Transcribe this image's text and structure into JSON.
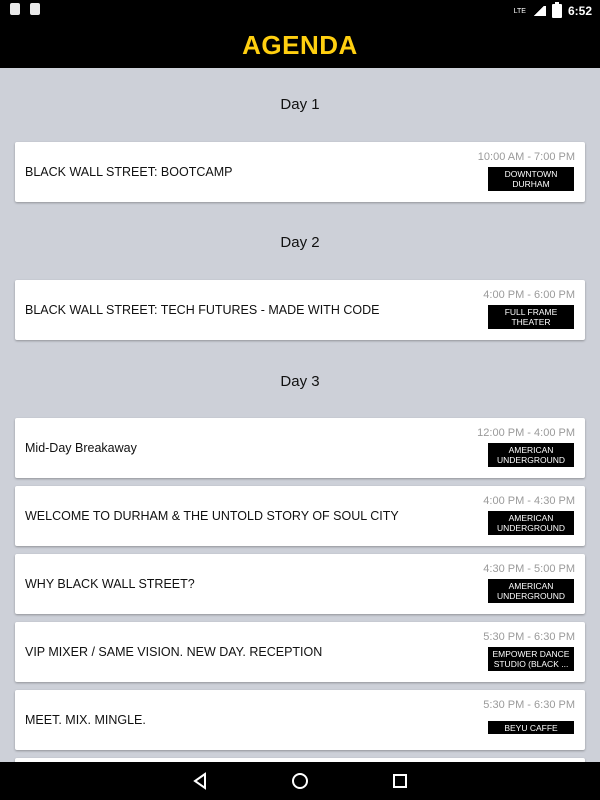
{
  "app": {
    "title": "AGENDA"
  },
  "status_bar": {
    "time": "6:52",
    "network": "LTE"
  },
  "days": [
    {
      "label": "Day 1",
      "events": [
        {
          "title": "BLACK WALL STREET: BOOTCAMP",
          "time": "10:00 AM - 7:00 PM",
          "location": "DOWNTOWN DURHAM"
        }
      ]
    },
    {
      "label": "Day 2",
      "events": [
        {
          "title": "BLACK WALL STREET: TECH FUTURES - MADE WITH CODE",
          "time": "4:00 PM - 6:00 PM",
          "location": "FULL FRAME THEATER"
        }
      ]
    },
    {
      "label": "Day 3",
      "events": [
        {
          "title": "Mid-Day Breakaway",
          "time": "12:00 PM - 4:00 PM",
          "location": "AMERICAN UNDERGROUND"
        },
        {
          "title": "WELCOME TO DURHAM & THE UNTOLD STORY OF SOUL CITY",
          "time": "4:00 PM - 4:30 PM",
          "location": "AMERICAN UNDERGROUND"
        },
        {
          "title": "WHY BLACK WALL STREET?",
          "time": "4:30 PM - 5:00 PM",
          "location": "AMERICAN UNDERGROUND"
        },
        {
          "title": "VIP MIXER / SAME VISION. NEW DAY. RECEPTION",
          "time": "5:30 PM - 6:30 PM",
          "location": "EMPOWER DANCE STUDIO (BLACK ..."
        },
        {
          "title": "MEET. MIX. MINGLE.",
          "time": "5:30 PM - 6:30 PM",
          "location": "BEYU CAFFE"
        }
      ]
    }
  ],
  "nav": {
    "back_icon": "back-triangle",
    "home_icon": "home-circle",
    "recent_icon": "recent-square"
  }
}
